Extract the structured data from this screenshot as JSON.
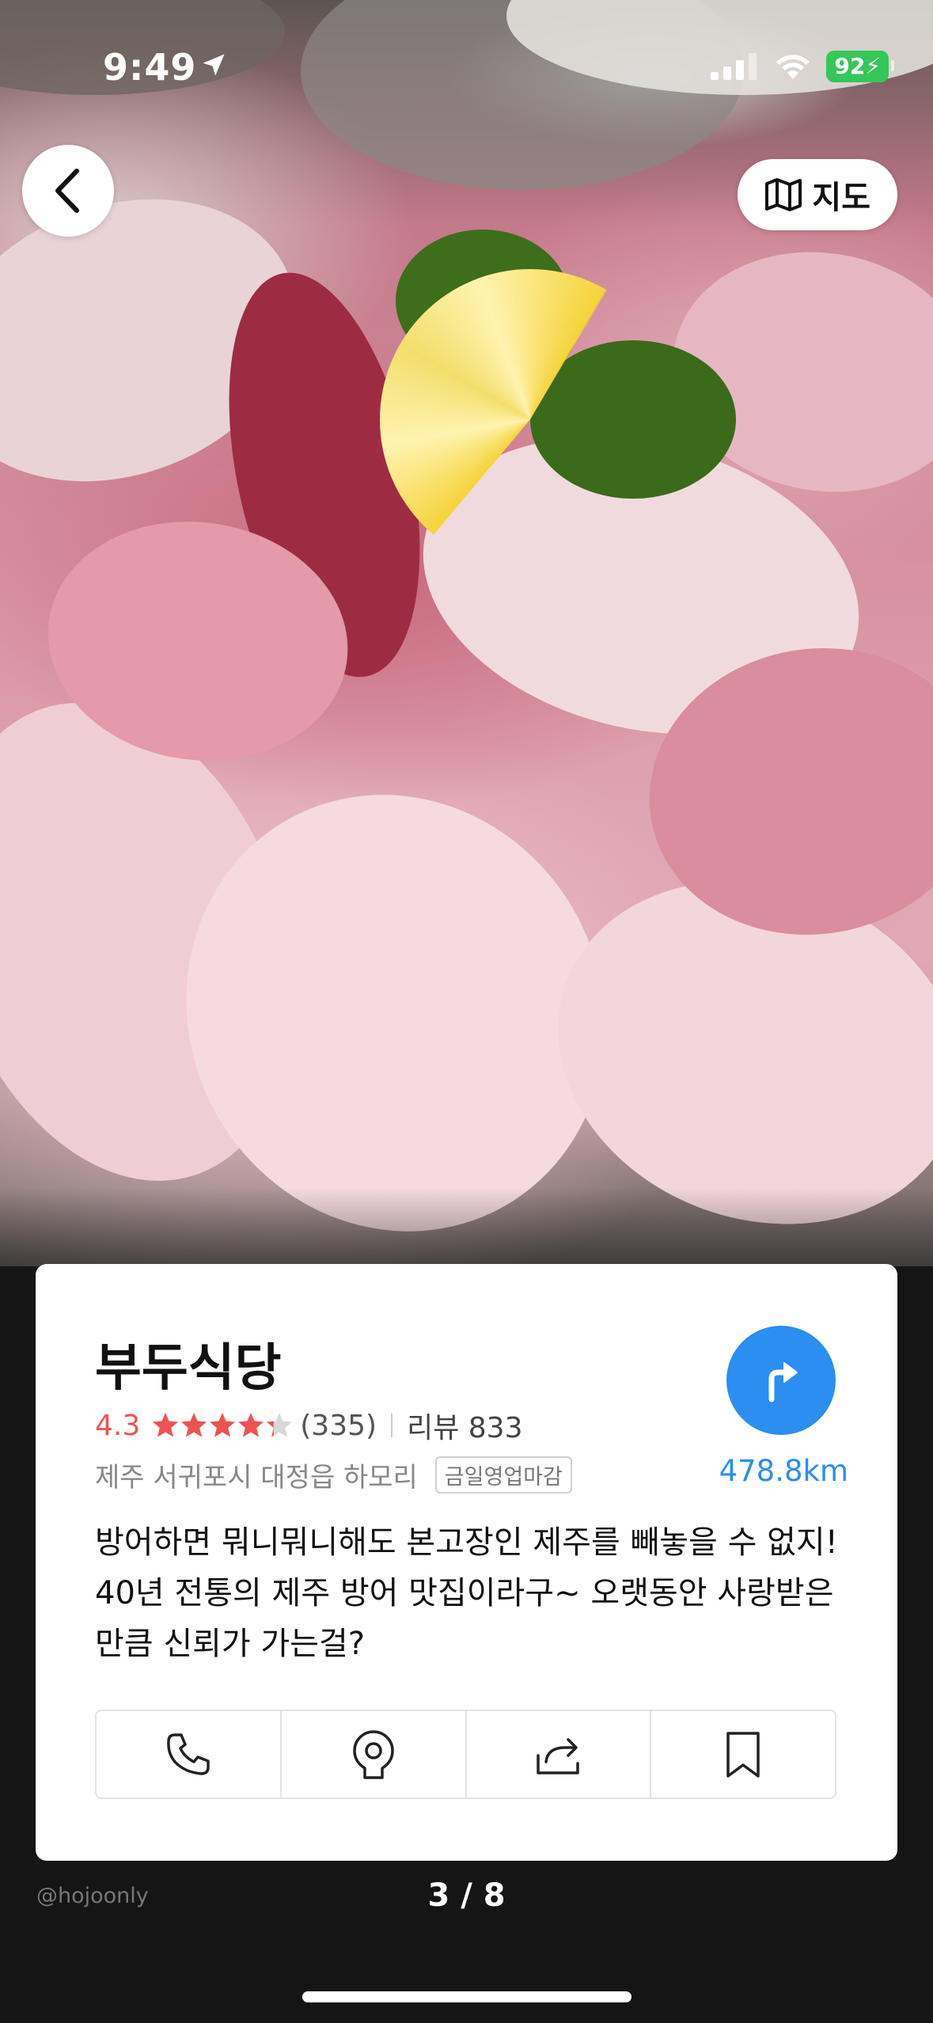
{
  "status": {
    "time": "9:49",
    "battery": "92"
  },
  "nav": {
    "map_label": "지도"
  },
  "place": {
    "name": "부두식당",
    "rating": "4.3",
    "rating_value": 4.3,
    "rating_max": 5,
    "rating_count": "(335)",
    "review_label": "리뷰 833",
    "address": "제주 서귀포시 대정읍 하모리",
    "hours_badge": "금일영업마감",
    "distance": "478.8km",
    "description": "방어하면 뭐니뭐니해도 본고장인 제주를 빼놓을 수 없지! 40년 전통의 제주 방어 맛집이라구~ 오랫동안 사랑받은 만큼 신뢰가 가는걸?"
  },
  "actions": [
    "phone-icon",
    "location-pin-icon",
    "share-icon",
    "bookmark-icon"
  ],
  "footer": {
    "credit": "@hojoonly",
    "pager": "3 / 8"
  },
  "colors": {
    "accent": "#2b8ef0",
    "rating": "#ef5350",
    "battery": "#34c759"
  }
}
